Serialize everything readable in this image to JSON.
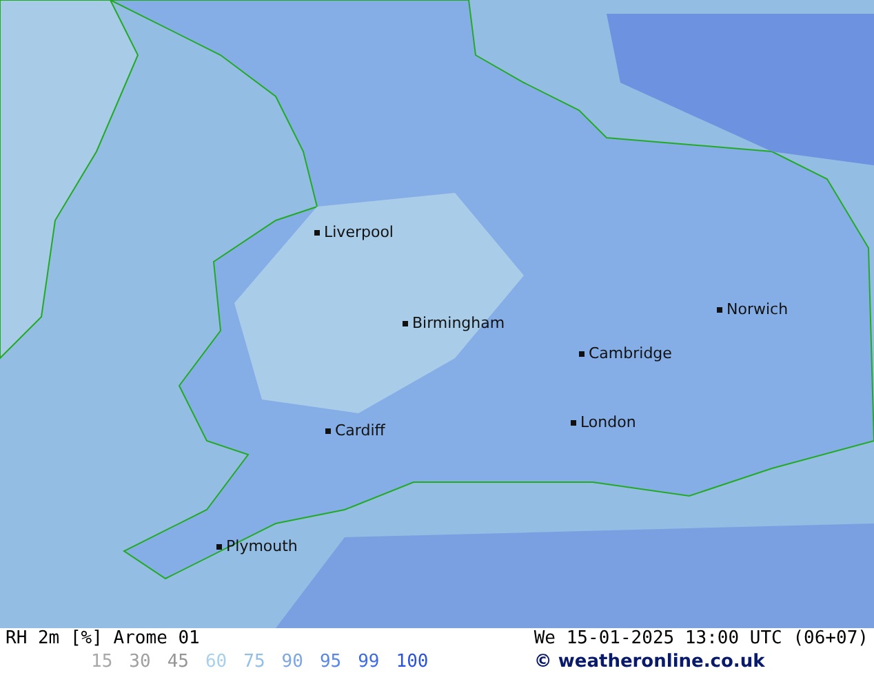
{
  "map": {
    "cities": [
      {
        "name": "Liverpool"
      },
      {
        "name": "Birmingham"
      },
      {
        "name": "Norwich"
      },
      {
        "name": "Cambridge"
      },
      {
        "name": "London"
      },
      {
        "name": "Cardiff"
      },
      {
        "name": "Plymouth"
      }
    ]
  },
  "footer": {
    "title": "RH 2m [%] Arome 01",
    "time": "We 15-01-2025 13:00 UTC (06+07)",
    "legend": [
      {
        "label": "15",
        "color": "#a8a8a8"
      },
      {
        "label": "30",
        "color": "#a0a0a0"
      },
      {
        "label": "45",
        "color": "#969696"
      },
      {
        "label": "60",
        "color": "#a8d0ec"
      },
      {
        "label": "75",
        "color": "#94bfe6"
      },
      {
        "label": "90",
        "color": "#7ea6e6"
      },
      {
        "label": "95",
        "color": "#5a86e6"
      },
      {
        "label": "99",
        "color": "#3e6ae6"
      },
      {
        "label": "100",
        "color": "#2a52e0"
      }
    ],
    "credit": "© weatheronline.co.uk"
  }
}
